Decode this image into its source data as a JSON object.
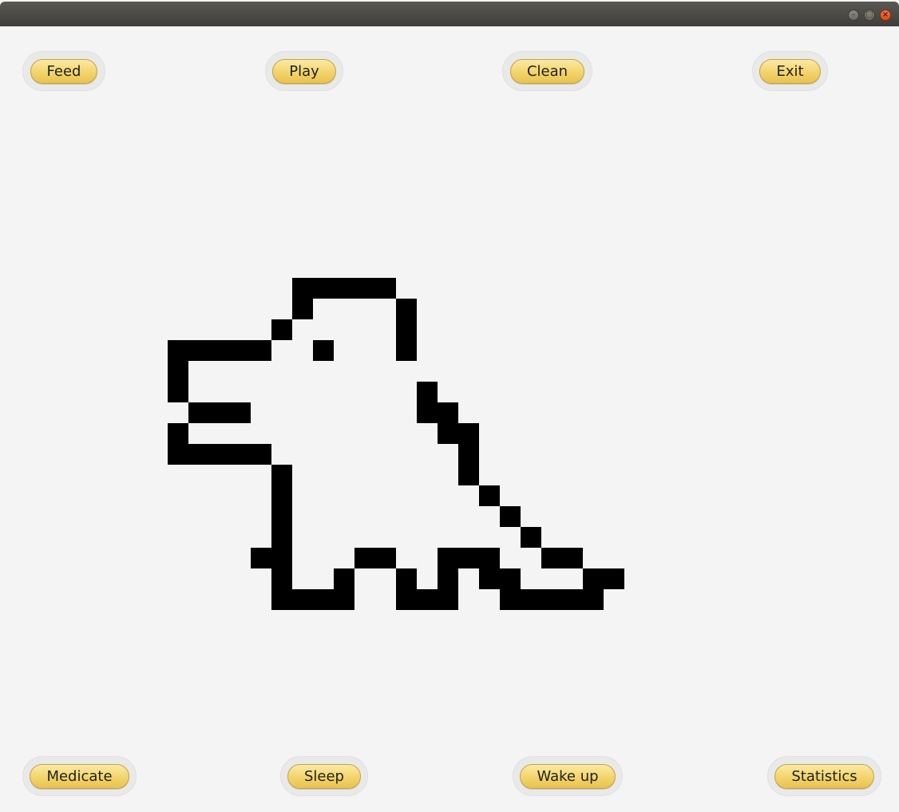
{
  "window": {
    "controls": [
      "minimize-icon",
      "maximize-icon",
      "close-icon"
    ]
  },
  "top_actions": [
    {
      "label": "Feed"
    },
    {
      "label": "Play"
    },
    {
      "label": "Clean"
    },
    {
      "label": "Exit"
    }
  ],
  "bottom_actions": [
    {
      "label": "Medicate"
    },
    {
      "label": "Sleep"
    },
    {
      "label": "Wake up"
    },
    {
      "label": "Statistics"
    }
  ],
  "pet": {
    "sprite": "pixel-dinosaur",
    "color": "#000000"
  },
  "colors": {
    "background": "#f4f4f4",
    "button_gold": "#f3d670",
    "titlebar": "#4a4945",
    "close_accent": "#e8561f"
  }
}
